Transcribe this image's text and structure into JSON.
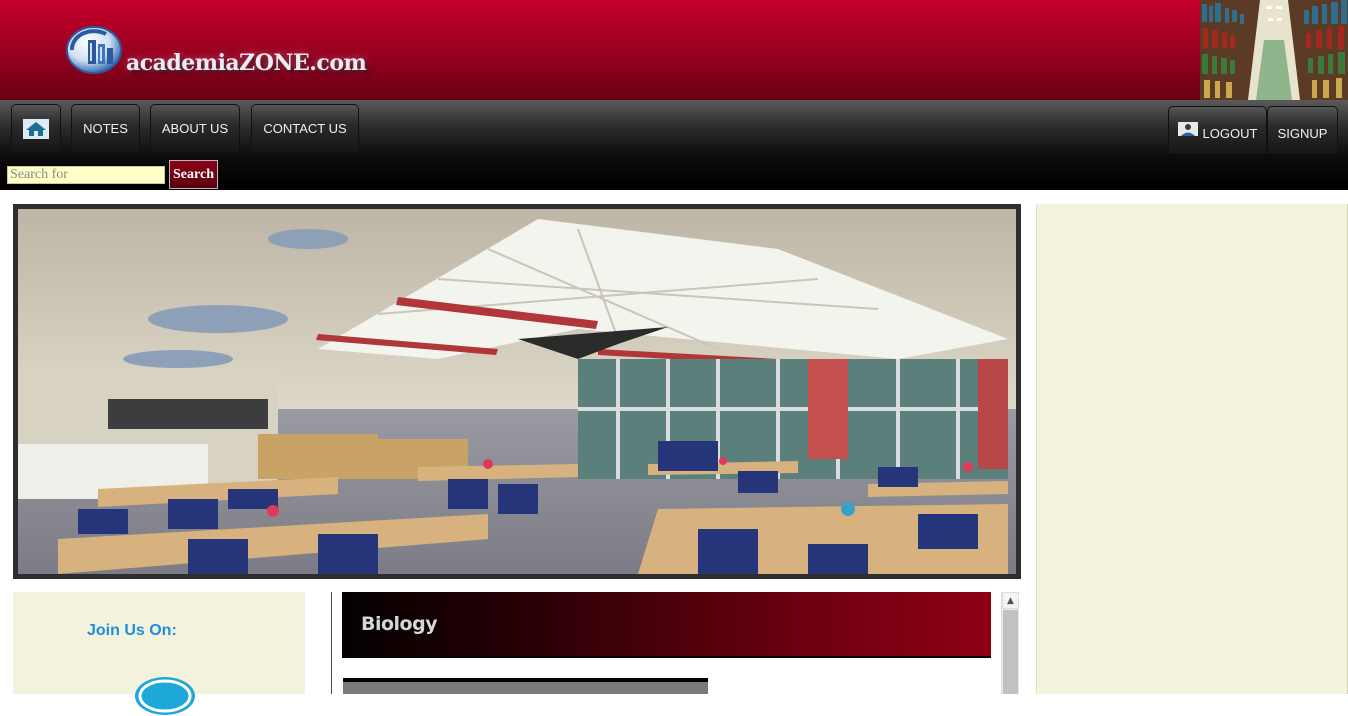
{
  "site": {
    "logo_text": "academiaZONE.com"
  },
  "nav": {
    "home_icon": "home-icon",
    "notes": "NOTES",
    "about": "ABOUT US",
    "contact": "CONTACT US",
    "logout": "LOGOUT",
    "signup": "SIGNUP",
    "user_icon": "user-icon"
  },
  "search": {
    "placeholder": "Search for",
    "value": "",
    "button": "Search"
  },
  "sidebar_left": {
    "join_title": "Join Us On:"
  },
  "content": {
    "subject_title": "Biology"
  },
  "colors": {
    "header_red": "#c4002c",
    "nav_black": "#000000",
    "join_blue": "#1e8fe0",
    "panel_cream": "#f4f4dc",
    "input_yellow": "#ffffc8"
  }
}
